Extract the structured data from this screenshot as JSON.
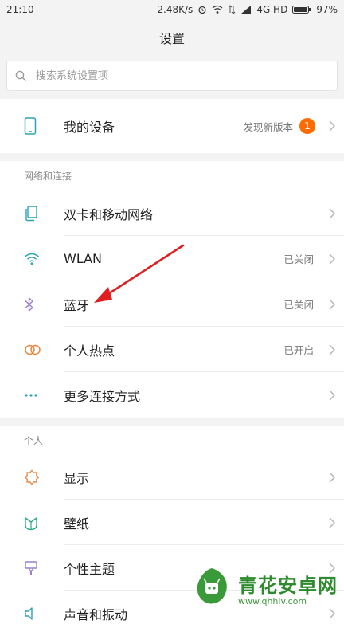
{
  "status_bar": {
    "time": "21:10",
    "speed": "2.48K/s",
    "network": "4G HD",
    "battery": "97%"
  },
  "header": {
    "title": "设置"
  },
  "search": {
    "placeholder": "搜索系统设置项"
  },
  "device": {
    "label": "我的设备",
    "value": "发现新版本",
    "badge": "1",
    "icon": "phone-icon"
  },
  "sections": {
    "network": {
      "title": "网络和连接",
      "items": [
        {
          "label": "双卡和移动网络",
          "value": "",
          "icon": "sim-cards-icon"
        },
        {
          "label": "WLAN",
          "value": "已关闭",
          "icon": "wifi-icon"
        },
        {
          "label": "蓝牙",
          "value": "已关闭",
          "icon": "bluetooth-icon"
        },
        {
          "label": "个人热点",
          "value": "已开启",
          "icon": "hotspot-icon"
        },
        {
          "label": "更多连接方式",
          "value": "",
          "icon": "more-dots-icon"
        }
      ]
    },
    "personal": {
      "title": "个人",
      "items": [
        {
          "label": "显示",
          "value": "",
          "icon": "sun-icon"
        },
        {
          "label": "壁纸",
          "value": "",
          "icon": "wallpaper-icon"
        },
        {
          "label": "个性主题",
          "value": "",
          "icon": "theme-brush-icon"
        },
        {
          "label": "声音和振动",
          "value": "",
          "icon": "sound-icon"
        }
      ]
    }
  },
  "watermark": {
    "title": "青花安卓网",
    "url": "www.qhhlv.com"
  },
  "colors": {
    "accent": "#ff6a00",
    "icon_orange": "#e8833a",
    "icon_teal": "#2aa3b8",
    "icon_purple": "#9b7fd0",
    "annotation_arrow": "#e02020",
    "watermark_green": "#2d8a2d"
  }
}
